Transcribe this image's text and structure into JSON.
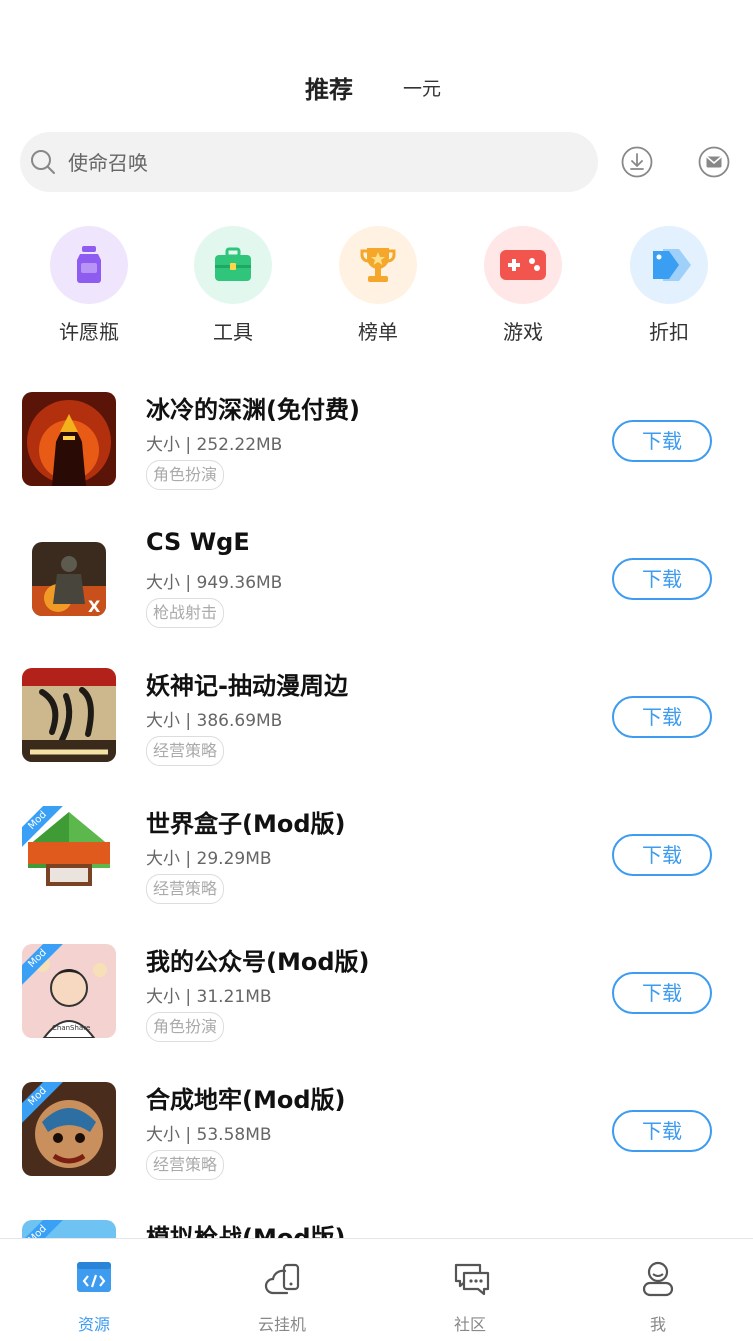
{
  "header": {
    "tab_main": "推荐",
    "tab_sub": "一元"
  },
  "search": {
    "placeholder": "使命召唤"
  },
  "categories": [
    {
      "label": "许愿瓶",
      "icon": "wish-bottle-icon",
      "color": "#8e5cf0"
    },
    {
      "label": "工具",
      "icon": "toolbox-icon",
      "color": "#2fc57a"
    },
    {
      "label": "榜单",
      "icon": "trophy-icon",
      "color": "#f4a72a"
    },
    {
      "label": "游戏",
      "icon": "gamepad-icon",
      "color": "#f2554d"
    },
    {
      "label": "折扣",
      "icon": "price-tag-icon",
      "color": "#3a9ff2"
    }
  ],
  "apps": [
    {
      "name": "冰冷的深渊(免付费)",
      "size": "大小 | 252.22MB",
      "tag": "角色扮演",
      "button": "下载"
    },
    {
      "name": "CS WgE",
      "size": "大小 | 949.36MB",
      "tag": "枪战射击",
      "button": "下载"
    },
    {
      "name": "妖神记-抽动漫周边",
      "size": "大小 | 386.69MB",
      "tag": "经营策略",
      "button": "下载"
    },
    {
      "name": "世界盒子(Mod版)",
      "size": "大小 | 29.29MB",
      "tag": "经营策略",
      "button": "下载",
      "badge": "Mod"
    },
    {
      "name": "我的公众号(Mod版)",
      "size": "大小 | 31.21MB",
      "tag": "角色扮演",
      "button": "下载",
      "badge": "Mod"
    },
    {
      "name": "合成地牢(Mod版)",
      "size": "大小 | 53.58MB",
      "tag": "经营策略",
      "button": "下载",
      "badge": "Mod"
    },
    {
      "name": "模拟枪战(Mod版)",
      "badge": "Mod"
    }
  ],
  "tabbar": [
    {
      "label": "资源",
      "icon": "code-window-icon",
      "active": true
    },
    {
      "label": "云挂机",
      "icon": "cloud-phone-icon",
      "active": false
    },
    {
      "label": "社区",
      "icon": "chat-bubbles-icon",
      "active": false
    },
    {
      "label": "我",
      "icon": "user-icon",
      "active": false
    }
  ],
  "colors": {
    "accent": "#3d9bf0",
    "search_bg": "#f2f2f2"
  }
}
